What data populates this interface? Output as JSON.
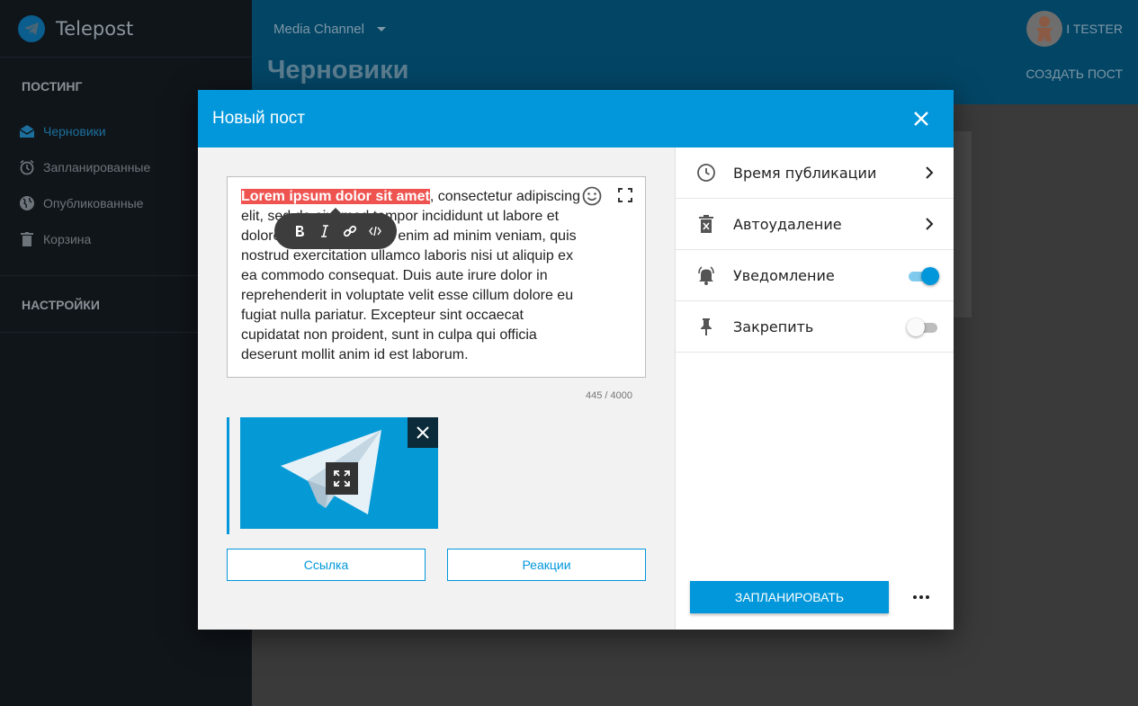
{
  "app": {
    "name": "Telepost"
  },
  "sidebar": {
    "section_posting": "ПОСТИНГ",
    "items": [
      {
        "label": "Черновики",
        "icon": "drafts-icon"
      },
      {
        "label": "Запланированные",
        "icon": "alarm-icon"
      },
      {
        "label": "Опубликованные",
        "icon": "globe-icon"
      },
      {
        "label": "Корзина",
        "icon": "trash-icon"
      }
    ],
    "section_settings": "НАСТРОЙКИ"
  },
  "header": {
    "channel": "Media Channel",
    "page_title": "Черновики",
    "user_name": "I TESTER",
    "create_post": "СОЗДАТЬ ПОСТ"
  },
  "dialog": {
    "title": "Новый пост",
    "editor": {
      "highlighted": "Lorem ipsum dolor sit amet",
      "text": ", consectetur adipiscing elit, sed do eiusmod tempor incididunt ut labore et dolore magna aliqua. Ut enim ad minim veniam, quis nostrud exercitation ullamco laboris nisi ut aliquip ex ea commodo consequat. Duis aute irure dolor in reprehenderit in voluptate velit esse cillum dolore eu fugiat nulla pariatur. Excepteur sint occaecat cupidatat non proident, sunt in culpa qui officia deserunt mollit anim id est laborum.",
      "counter": "445 / 4000"
    },
    "buttons": {
      "link": "Ссылка",
      "reactions": "Реакции",
      "schedule": "ЗАПЛАНИРОВАТЬ"
    },
    "options": [
      {
        "label": "Время публикации",
        "type": "nav"
      },
      {
        "label": "Автоудаление",
        "type": "nav"
      },
      {
        "label": "Уведомление",
        "type": "toggle",
        "on": true
      },
      {
        "label": "Закрепить",
        "type": "toggle",
        "on": false
      }
    ]
  },
  "colors": {
    "accent": "#0297db",
    "highlight": "#ef5350"
  }
}
